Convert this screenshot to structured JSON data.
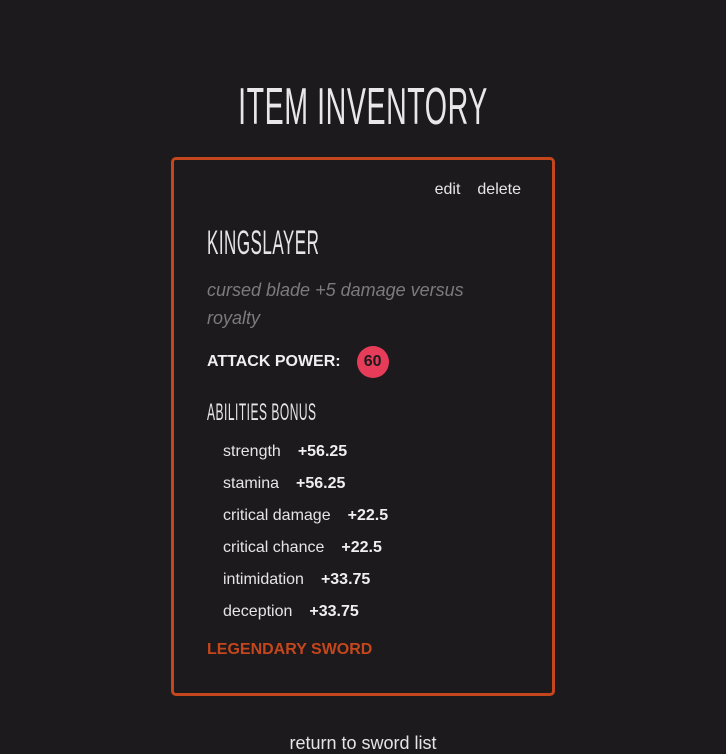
{
  "header": {
    "title": "ITEM INVENTORY"
  },
  "item": {
    "actions": {
      "edit_label": "edit",
      "delete_label": "delete"
    },
    "name": "KINGSLAYER",
    "description": "cursed blade +5 damage versus royalty",
    "attack_power_label": "ATTACK POWER:",
    "attack_power": "60",
    "abilities_heading": "ABILITIES BONUS",
    "abilities": [
      {
        "name": "strength",
        "value": "+56.25"
      },
      {
        "name": "stamina",
        "value": "+56.25"
      },
      {
        "name": "critical damage",
        "value": "+22.5"
      },
      {
        "name": "critical chance",
        "value": "+22.5"
      },
      {
        "name": "intimidation",
        "value": "+33.75"
      },
      {
        "name": "deception",
        "value": "+33.75"
      }
    ],
    "type_label": "LEGENDARY SWORD"
  },
  "footer": {
    "return_label": "return to sword list"
  },
  "colors": {
    "background": "#1c1a1d",
    "accent": "#c4461c",
    "badge": "#e63c5a",
    "muted_text": "#7d7a7e"
  }
}
